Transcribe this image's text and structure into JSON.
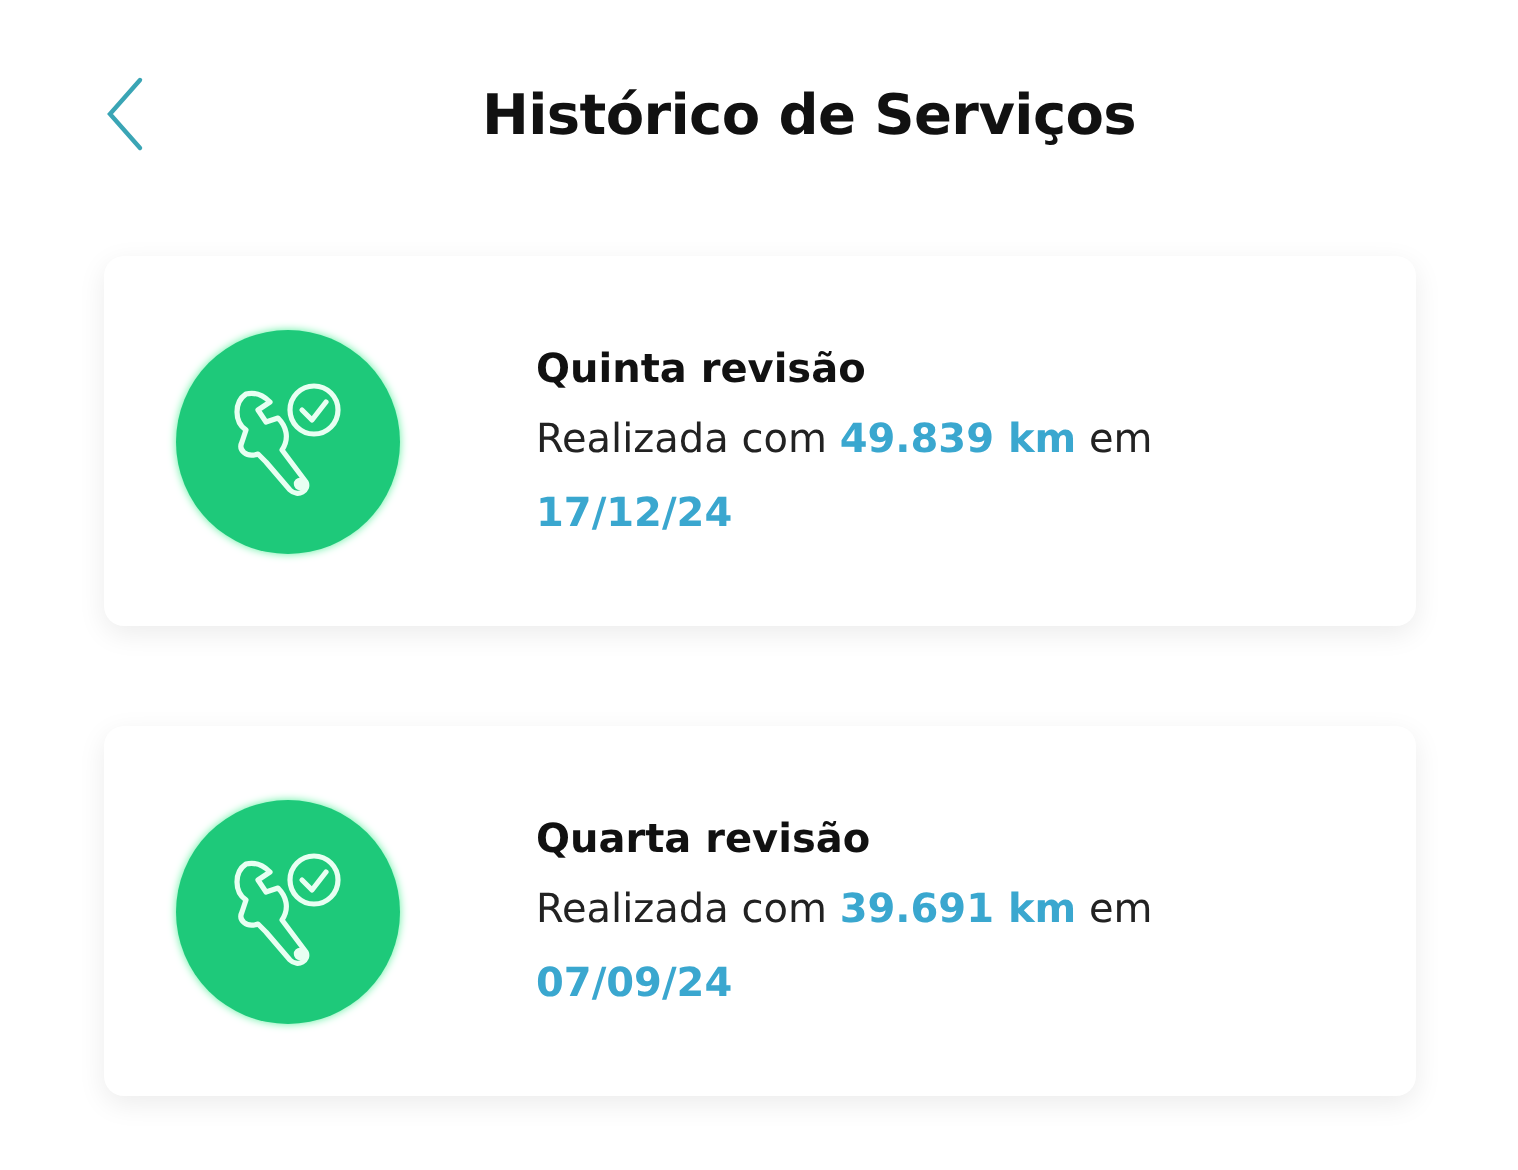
{
  "header": {
    "title": "Histórico de Serviços"
  },
  "services": [
    {
      "title": "Quinta revisão",
      "description": "Realizada com **49.839 km** em **17/12/24**"
    },
    {
      "title": "Quarta revisão",
      "description": "Realizada com **39.691 km** em **07/09/24**"
    }
  ]
}
